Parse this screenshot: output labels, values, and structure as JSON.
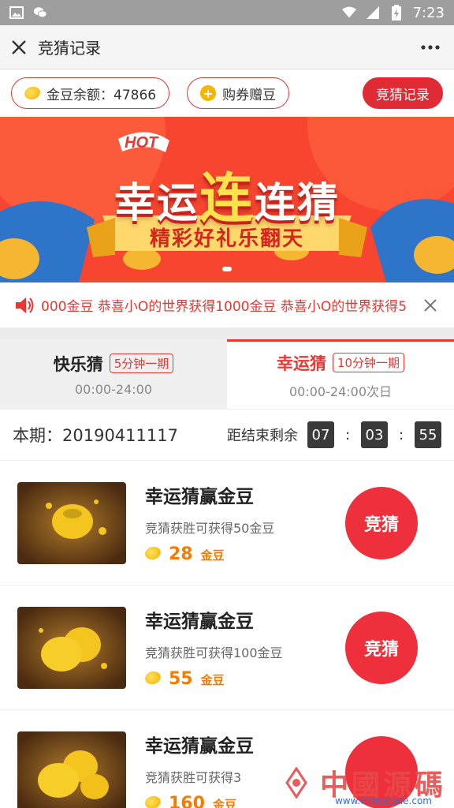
{
  "status_bar": {
    "time": "7:23"
  },
  "titlebar": {
    "title": "竞猜记录"
  },
  "pills": {
    "balance_label": "金豆余额：47866",
    "buy_label": "购券赠豆",
    "records_label": "竞猜记录"
  },
  "banner": {
    "hot": "HOT",
    "title_left": "幸运",
    "title_mid": "连",
    "title_right": "连猜",
    "subtitle": "精彩好礼乐翻天"
  },
  "notice": {
    "text": "000金豆 恭喜小O的世界获得1000金豆 恭喜小O的世界获得5"
  },
  "tabs": [
    {
      "name": "快乐猜",
      "badge": "5分钟一期",
      "time": "00:00-24:00"
    },
    {
      "name": "幸运猜",
      "badge": "10分钟一期",
      "time": "00:00-24:00次日"
    }
  ],
  "period": {
    "label": "本期：20190411117",
    "countdown_label": "距结束剩余",
    "hours": "07",
    "minutes": "03",
    "seconds": "55",
    "sep": ":"
  },
  "items": [
    {
      "title": "幸运猜赢金豆",
      "desc": "竞猜获胜可获得50金豆",
      "price": "28",
      "unit": "金豆",
      "button": "竞猜"
    },
    {
      "title": "幸运猜赢金豆",
      "desc": "竞猜获胜可获得100金豆",
      "price": "55",
      "unit": "金豆",
      "button": "竞猜"
    },
    {
      "title": "幸运猜赢金豆",
      "desc": "竞猜获胜可获得3",
      "price": "160",
      "unit": "金豆",
      "button": ""
    }
  ],
  "watermark": {
    "text": "中國源碼",
    "url": "www.chinacode.com"
  },
  "colors": {
    "accent": "#e53935",
    "button": "#ee2f3c",
    "price": "#f57c00"
  },
  "icons": [
    "image-icon",
    "wechat-icon",
    "wifi-icon",
    "signal-icon",
    "battery-icon",
    "close-icon",
    "more-icon",
    "bean-icon",
    "plus-icon",
    "speaker-icon"
  ]
}
